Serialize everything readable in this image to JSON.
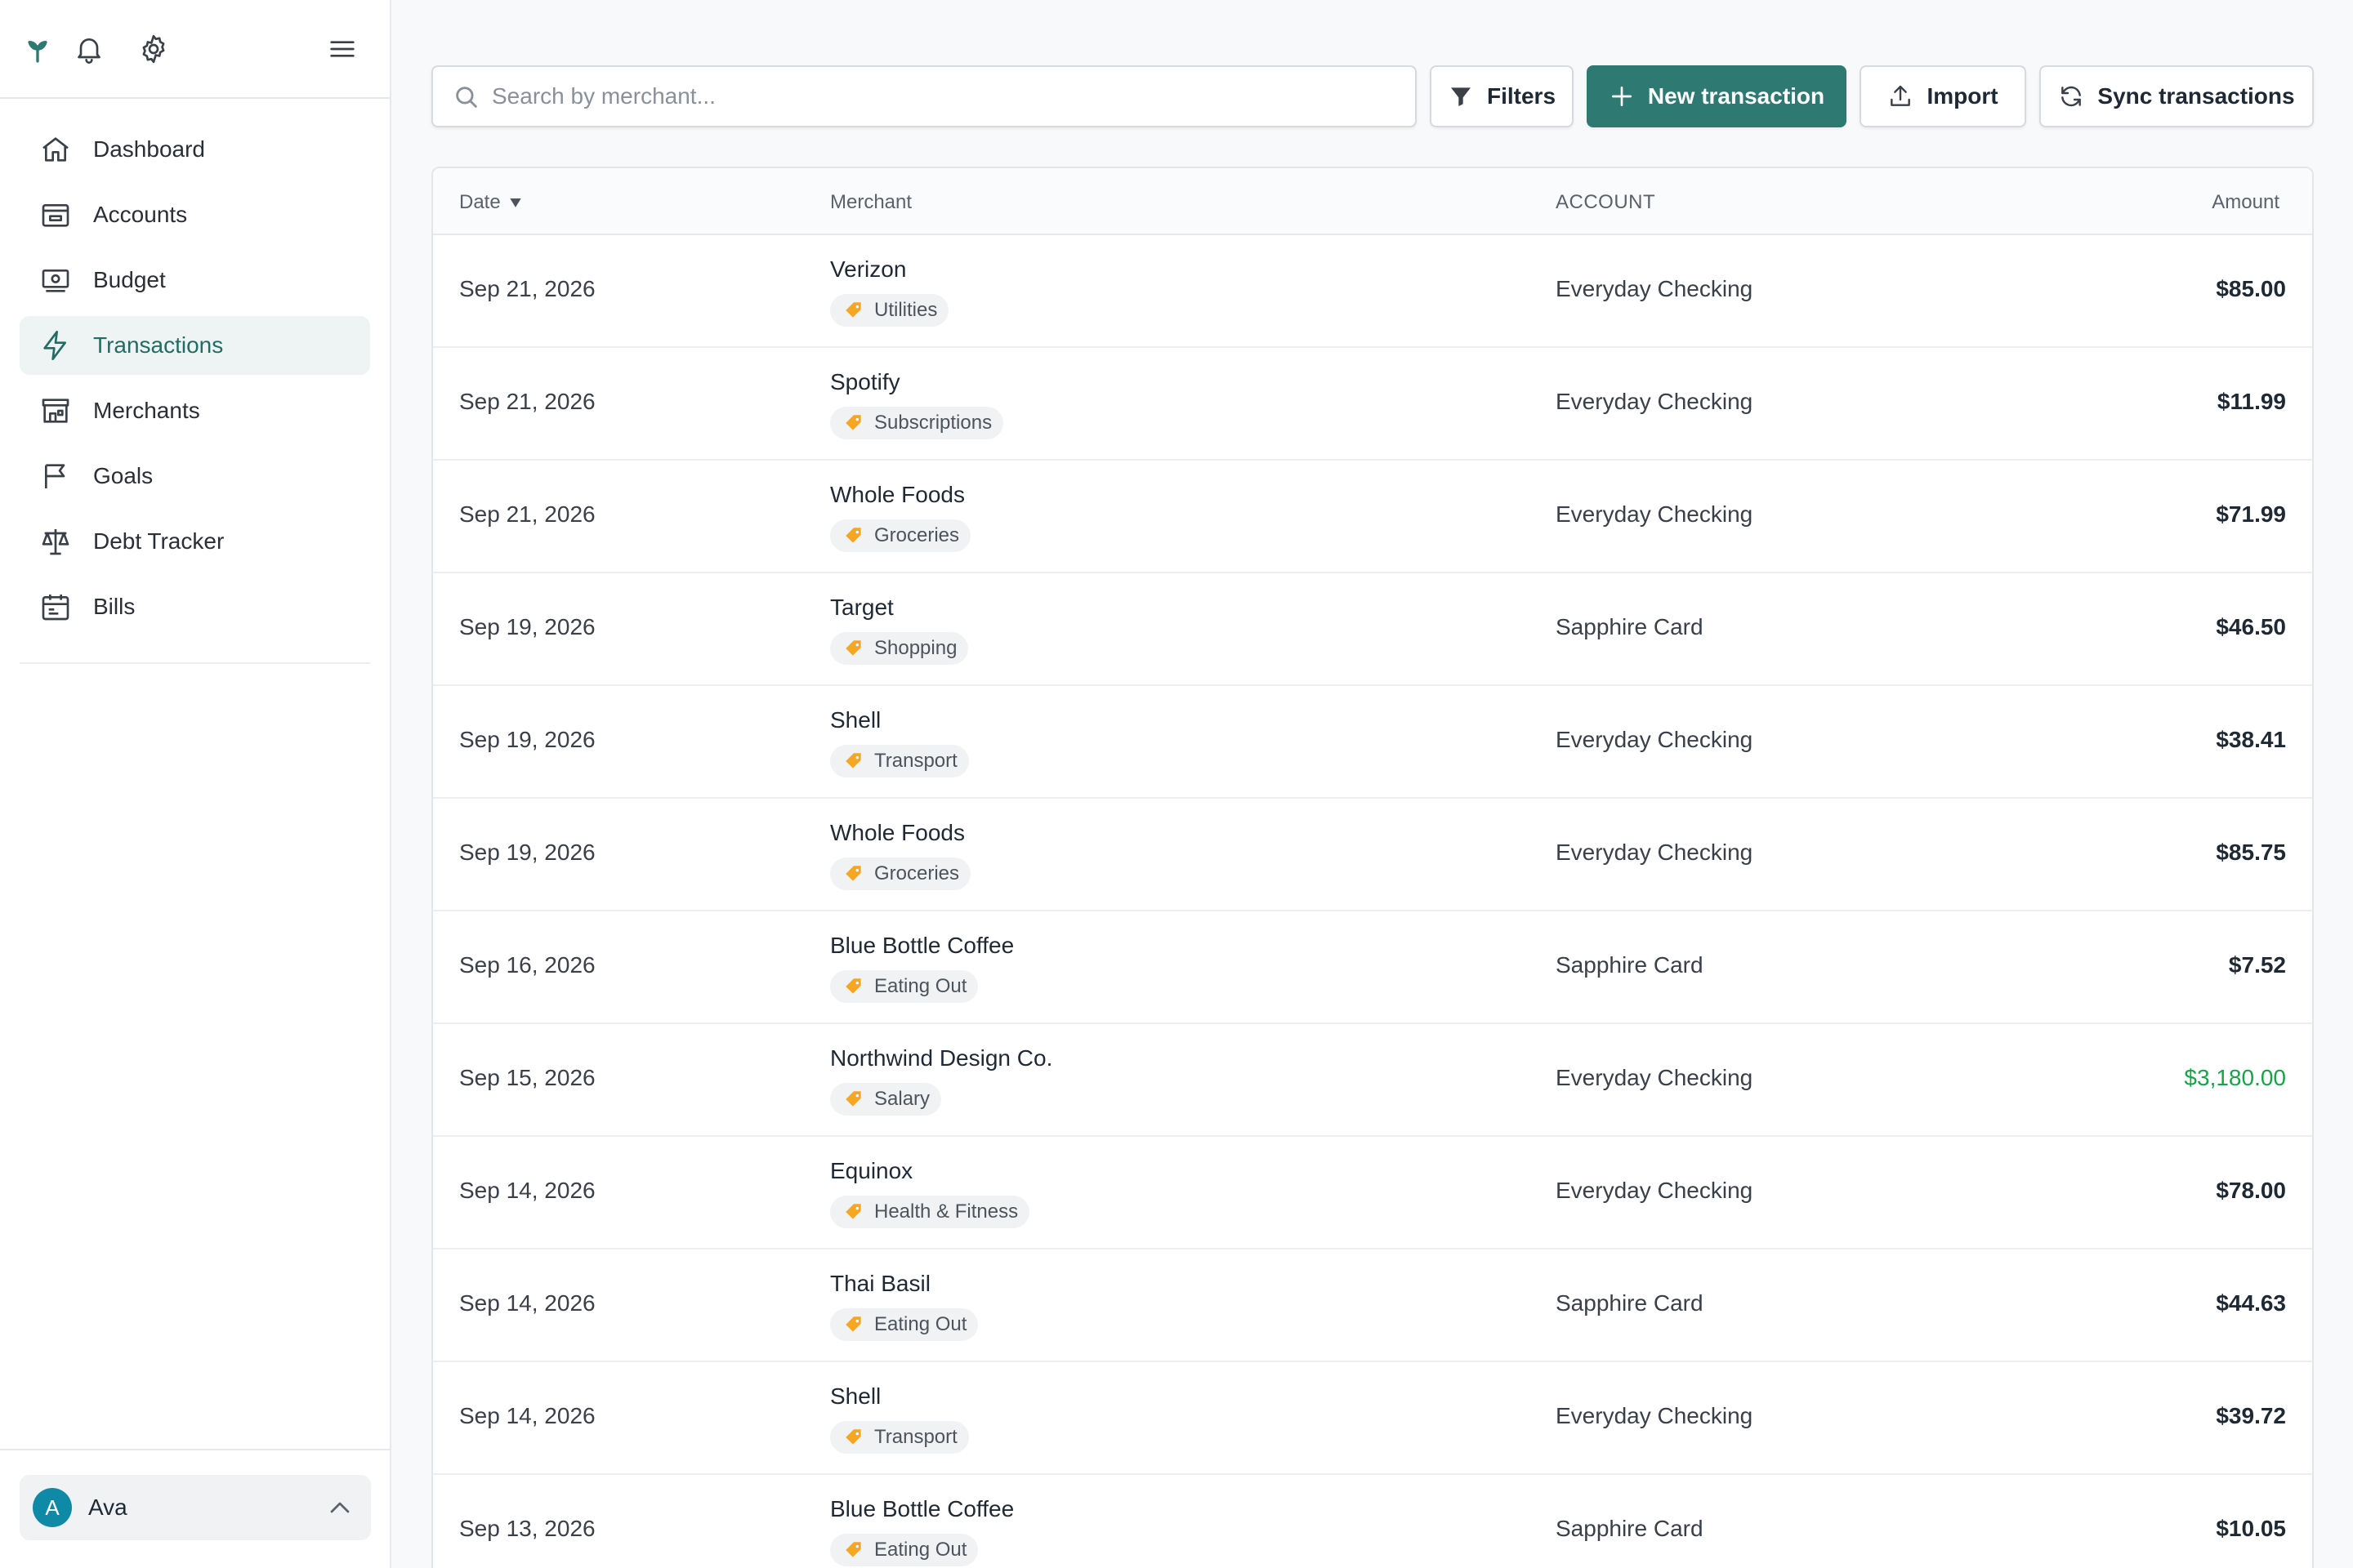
{
  "sidebar": {
    "top_icons": [
      "sprout-logo-icon",
      "bell-icon",
      "gear-icon",
      "menu-icon"
    ],
    "items": [
      {
        "label": "Dashboard",
        "icon": "home-icon"
      },
      {
        "label": "Accounts",
        "icon": "wallet-icon"
      },
      {
        "label": "Budget",
        "icon": "banknote-icon"
      },
      {
        "label": "Transactions",
        "icon": "bolt-icon",
        "active": true
      },
      {
        "label": "Merchants",
        "icon": "store-icon"
      },
      {
        "label": "Goals",
        "icon": "flag-icon"
      },
      {
        "label": "Debt Tracker",
        "icon": "scale-icon"
      },
      {
        "label": "Bills",
        "icon": "calendar-icon"
      }
    ],
    "user": {
      "initial": "A",
      "name": "Ava"
    }
  },
  "toolbar": {
    "search_placeholder": "Search by merchant...",
    "filters_label": "Filters",
    "new_label": "New transaction",
    "import_label": "Import",
    "sync_label": "Sync transactions"
  },
  "table": {
    "columns": {
      "date": "Date",
      "merchant": "Merchant",
      "account": "ACCOUNT",
      "amount": "Amount"
    },
    "rows": [
      {
        "date": "Sep 21, 2026",
        "merchant": "Verizon",
        "category": "Utilities",
        "account": "Everyday Checking",
        "amount": "$85.00"
      },
      {
        "date": "Sep 21, 2026",
        "merchant": "Spotify",
        "category": "Subscriptions",
        "account": "Everyday Checking",
        "amount": "$11.99"
      },
      {
        "date": "Sep 21, 2026",
        "merchant": "Whole Foods",
        "category": "Groceries",
        "account": "Everyday Checking",
        "amount": "$71.99"
      },
      {
        "date": "Sep 19, 2026",
        "merchant": "Target",
        "category": "Shopping",
        "account": "Sapphire Card",
        "amount": "$46.50"
      },
      {
        "date": "Sep 19, 2026",
        "merchant": "Shell",
        "category": "Transport",
        "account": "Everyday Checking",
        "amount": "$38.41"
      },
      {
        "date": "Sep 19, 2026",
        "merchant": "Whole Foods",
        "category": "Groceries",
        "account": "Everyday Checking",
        "amount": "$85.75"
      },
      {
        "date": "Sep 16, 2026",
        "merchant": "Blue Bottle Coffee",
        "category": "Eating Out",
        "account": "Sapphire Card",
        "amount": "$7.52"
      },
      {
        "date": "Sep 15, 2026",
        "merchant": "Northwind Design Co.",
        "category": "Salary",
        "account": "Everyday Checking",
        "amount": "$3,180.00",
        "income": true
      },
      {
        "date": "Sep 14, 2026",
        "merchant": "Equinox",
        "category": "Health & Fitness",
        "account": "Everyday Checking",
        "amount": "$78.00"
      },
      {
        "date": "Sep 14, 2026",
        "merchant": "Thai Basil",
        "category": "Eating Out",
        "account": "Sapphire Card",
        "amount": "$44.63"
      },
      {
        "date": "Sep 14, 2026",
        "merchant": "Shell",
        "category": "Transport",
        "account": "Everyday Checking",
        "amount": "$39.72"
      },
      {
        "date": "Sep 13, 2026",
        "merchant": "Blue Bottle Coffee",
        "category": "Eating Out",
        "account": "Sapphire Card",
        "amount": "$10.05"
      }
    ]
  },
  "colors": {
    "accent": "#2e7a72",
    "income": "#18a34a",
    "tag_icon": "#f5a623",
    "avatar": "#0f8aa6"
  }
}
